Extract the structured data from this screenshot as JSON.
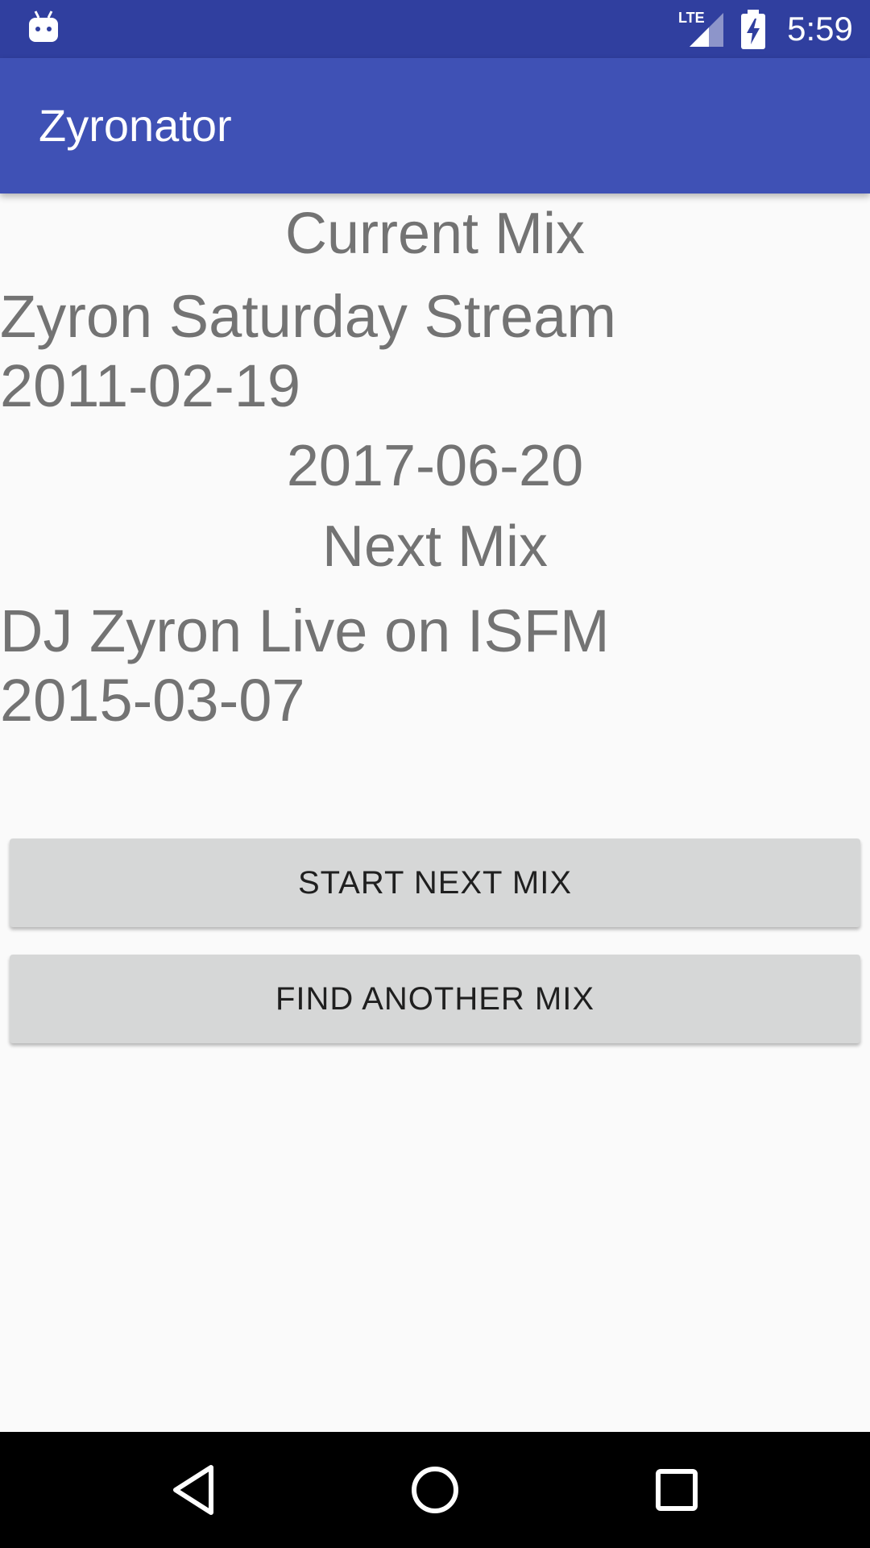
{
  "status_bar": {
    "time": "5:59",
    "network_label": "LTE",
    "icons": [
      "android-icon",
      "lte-signal-icon",
      "battery-charging-icon"
    ]
  },
  "app_bar": {
    "title": "Zyronator",
    "color": "#3f51b5",
    "status_color": "#303f9f"
  },
  "current_mix": {
    "heading": "Current Mix",
    "name": "Zyron Saturday Stream",
    "date": "2011-02-19",
    "played_date": "2017-06-20"
  },
  "next_mix": {
    "heading": "Next Mix",
    "name": "DJ Zyron Live on ISFM",
    "date": "2015-03-07"
  },
  "buttons": {
    "start_next": "START NEXT MIX",
    "find_another": "FIND ANOTHER MIX"
  },
  "nav_bar": {
    "icons": [
      "back-icon",
      "home-icon",
      "recents-icon"
    ]
  }
}
